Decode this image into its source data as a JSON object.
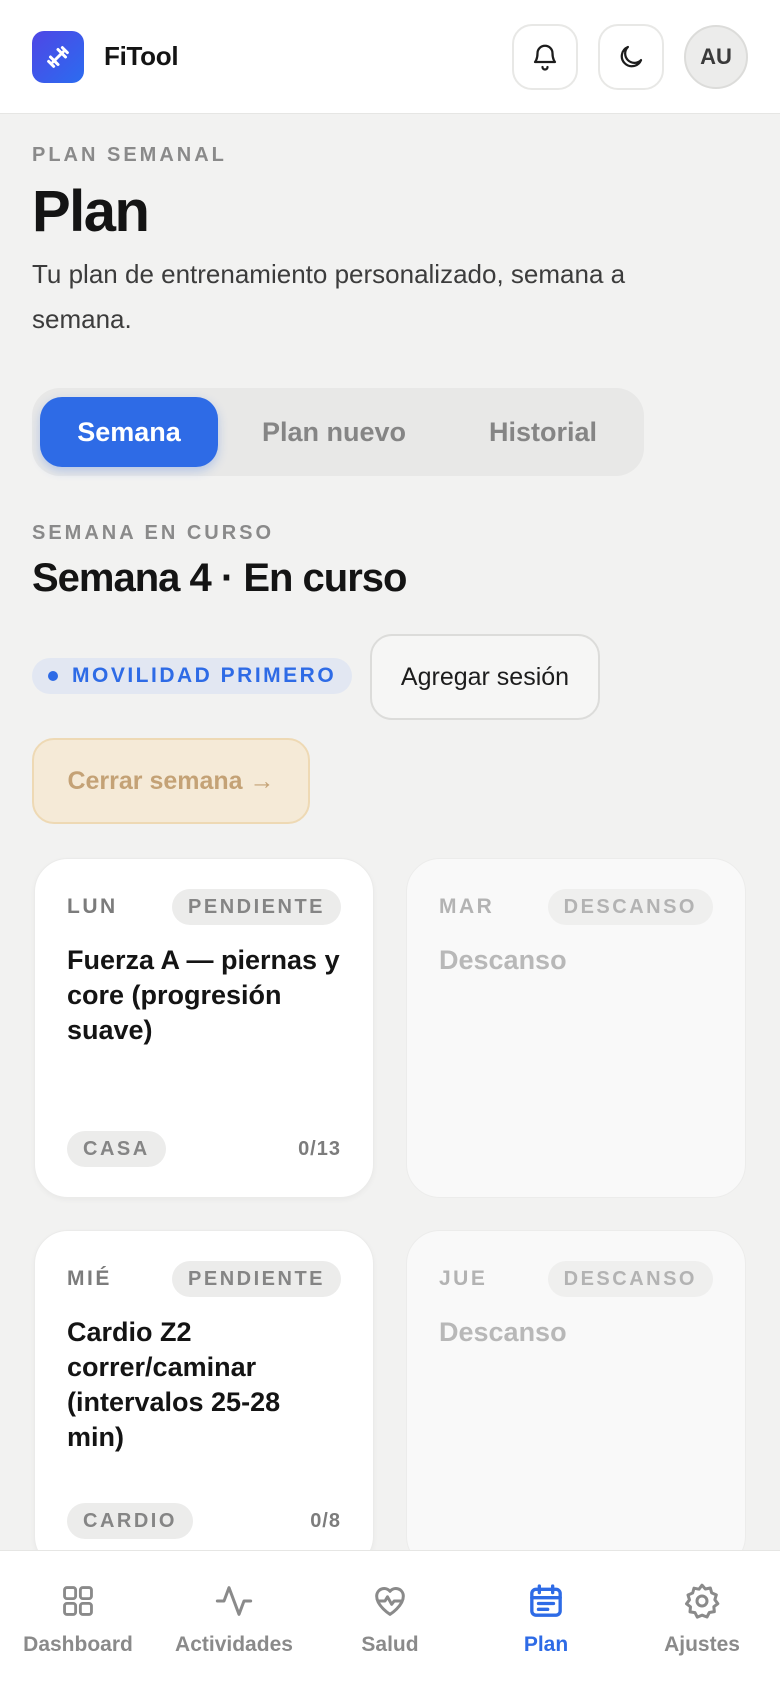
{
  "app": {
    "title": "FiTool",
    "avatar_initials": "AU",
    "accent_color": "#2e6be6"
  },
  "header": {
    "icons": [
      "dumbbell-icon",
      "bell-icon",
      "moon-icon"
    ]
  },
  "intro": {
    "eyebrow": "PLAN SEMANAL",
    "title": "Plan",
    "description": "Tu plan de entrenamiento personalizado, semana a semana."
  },
  "tabs": [
    {
      "label": "Semana",
      "active": true
    },
    {
      "label": "Plan nuevo",
      "active": false
    },
    {
      "label": "Historial",
      "active": false
    }
  ],
  "week": {
    "eyebrow": "SEMANA EN CURSO",
    "title": "Semana 4 · En curso",
    "focus_badge": "MOVILIDAD PRIMERO",
    "add_session_label": "Agregar sesión",
    "close_week_label": "Cerrar semana →"
  },
  "days": [
    {
      "day": "LUN",
      "status": "PENDIENTE",
      "title": "Fuerza A — piernas y core (progresión suave)",
      "type": "CASA",
      "progress": "0/13",
      "rest": false
    },
    {
      "day": "MAR",
      "status": "DESCANSO",
      "title": "Descanso",
      "rest": true
    },
    {
      "day": "MIÉ",
      "status": "PENDIENTE",
      "title": "Cardio Z2 correr/caminar (intervalos 25-28 min)",
      "type": "CARDIO",
      "progress": "0/8",
      "rest": false
    },
    {
      "day": "JUE",
      "status": "DESCANSO",
      "title": "Descanso",
      "rest": true
    }
  ],
  "nav": [
    {
      "label": "Dashboard",
      "icon": "grid-icon",
      "active": false
    },
    {
      "label": "Actividades",
      "icon": "activity-icon",
      "active": false
    },
    {
      "label": "Salud",
      "icon": "heart-pulse-icon",
      "active": false
    },
    {
      "label": "Plan",
      "icon": "calendar-icon",
      "active": true
    },
    {
      "label": "Ajustes",
      "icon": "gear-icon",
      "active": false
    }
  ]
}
